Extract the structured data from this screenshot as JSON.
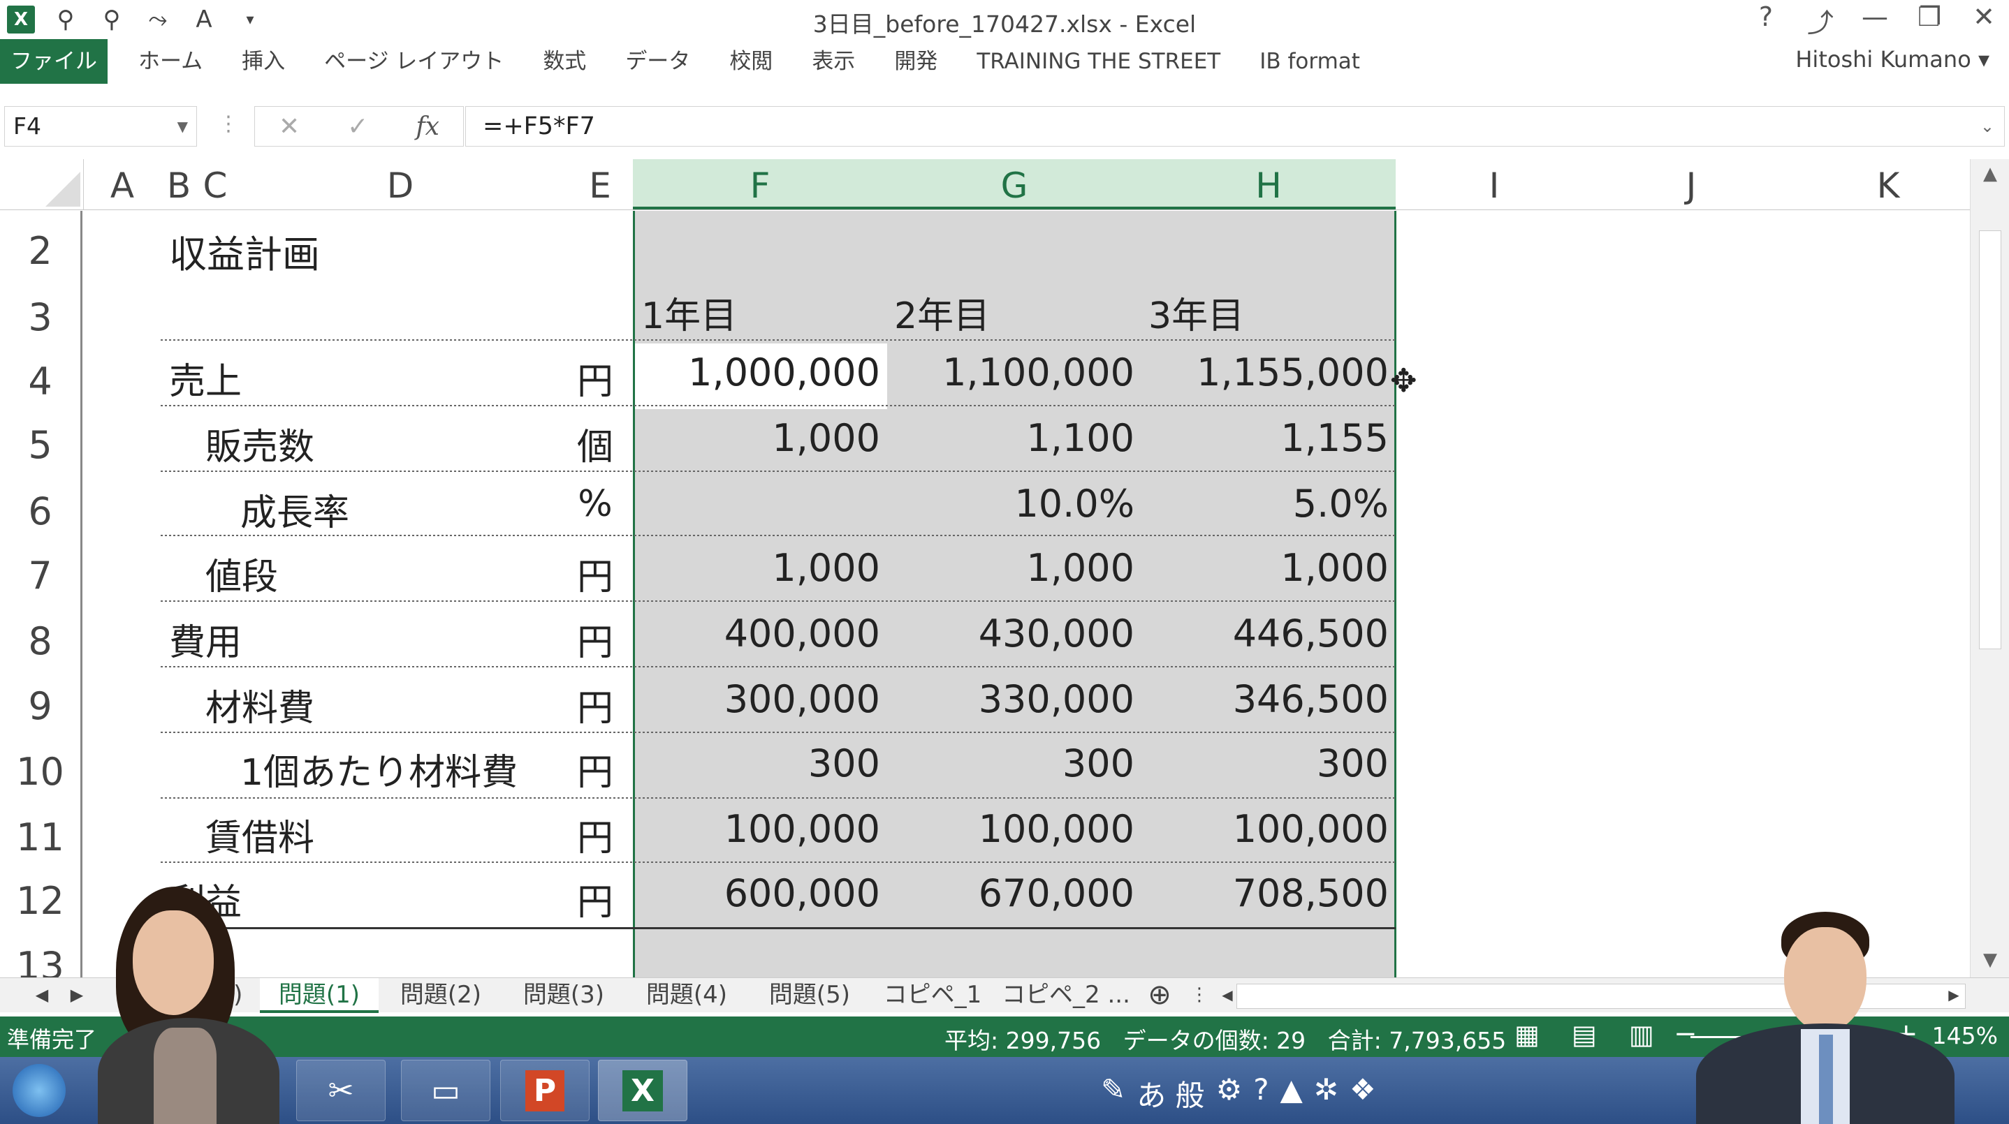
{
  "window": {
    "title": "3日目_before_170427.xlsx - Excel",
    "controls": [
      "?",
      "⤴",
      "—",
      "❐",
      "✕"
    ]
  },
  "ribbon": {
    "tabs": [
      "ファイル",
      "ホーム",
      "挿入",
      "ページ レイアウト",
      "数式",
      "データ",
      "校閲",
      "表示",
      "開発",
      "TRAINING THE STREET",
      "IB format"
    ],
    "user": "Hitoshi Kumano"
  },
  "formula_bar": {
    "name_box": "F4",
    "cancel": "✕",
    "enter": "✓",
    "fx": "fx",
    "formula": "=+F5*F7"
  },
  "columns": [
    "A",
    "B",
    "C",
    "D",
    "E",
    "F",
    "G",
    "H",
    "I",
    "J",
    "K"
  ],
  "rows": [
    "2",
    "3",
    "4",
    "5",
    "6",
    "7",
    "8",
    "9",
    "10",
    "11",
    "12",
    "13"
  ],
  "sheet": {
    "title": "収益計画",
    "year_headers": [
      "1年目",
      "2年目",
      "3年目"
    ],
    "lines": [
      {
        "label": "売上",
        "unit": "円",
        "values": [
          "1,000,000",
          "1,100,000",
          "1,155,000"
        ]
      },
      {
        "label": "販売数",
        "unit": "個",
        "values": [
          "1,000",
          "1,100",
          "1,155"
        ]
      },
      {
        "label": "成長率",
        "unit": "%",
        "values": [
          "",
          "10.0%",
          "5.0%"
        ]
      },
      {
        "label": "値段",
        "unit": "円",
        "values": [
          "1,000",
          "1,000",
          "1,000"
        ]
      },
      {
        "label": "費用",
        "unit": "円",
        "values": [
          "400,000",
          "430,000",
          "446,500"
        ]
      },
      {
        "label": "材料費",
        "unit": "円",
        "values": [
          "300,000",
          "330,000",
          "346,500"
        ]
      },
      {
        "label": "1個あたり材料費",
        "unit": "円",
        "values": [
          "300",
          "300",
          "300"
        ]
      },
      {
        "label": "賃借料",
        "unit": "円",
        "values": [
          "100,000",
          "100,000",
          "100,000"
        ]
      },
      {
        "label": "利益",
        "unit": "円",
        "values": [
          "600,000",
          "670,000",
          "708,500"
        ]
      }
    ]
  },
  "sheet_tabs": {
    "partial": "6)",
    "tabs": [
      "問題(1)",
      "問題(2)",
      "問題(3)",
      "問題(4)",
      "問題(5)",
      "コピペ_1",
      "コピペ_2 ..."
    ],
    "active": "問題(1)",
    "add": "⊕"
  },
  "status": {
    "ready": "準備完了",
    "average": "平均: 299,756",
    "count": "データの個数: 29",
    "sum": "合計: 7,793,655",
    "zoom": "145%"
  },
  "taskbar": {
    "apps": [
      "P",
      "X"
    ],
    "tray_text": "あ 般"
  }
}
